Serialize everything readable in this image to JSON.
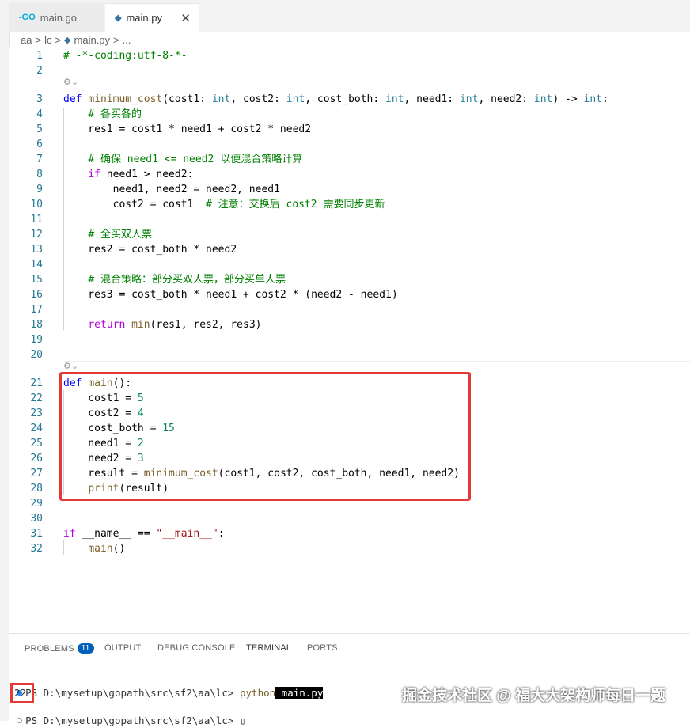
{
  "tabs": [
    {
      "label": "main.go",
      "icon": "go-icon"
    },
    {
      "label": "main.py",
      "icon": "python-icon",
      "close": "✕"
    }
  ],
  "breadcrumb": [
    "aa",
    ">",
    "lc",
    ">",
    "main.py",
    ">",
    "..."
  ],
  "codelens_icon": "⚙⌄",
  "lines": [
    {
      "n": "1",
      "html": "<span class=\"cm\"># -*-coding:utf-8-*-</span>"
    },
    {
      "n": "2",
      "html": ""
    },
    {
      "n": "3",
      "html": "<span class=\"kw\">def</span> <span class=\"fn\">minimum_cost</span>(cost1: <span class=\"ty\">int</span>, cost2: <span class=\"ty\">int</span>, cost_both: <span class=\"ty\">int</span>, need1: <span class=\"ty\">int</span>, need2: <span class=\"ty\">int</span>) -> <span class=\"ty\">int</span>:"
    },
    {
      "n": "4",
      "html": "    <span class=\"cm\"># 各买各的</span>"
    },
    {
      "n": "5",
      "html": "    res1 = cost1 * need1 + cost2 * need2"
    },
    {
      "n": "6",
      "html": ""
    },
    {
      "n": "7",
      "html": "    <span class=\"cm\"># 确保 need1 <= need2 以便混合策略计算</span>"
    },
    {
      "n": "8",
      "html": "    <span class=\"ctl\">if</span> need1 > need2:"
    },
    {
      "n": "9",
      "html": "        need1, need2 = need2, need1"
    },
    {
      "n": "10",
      "html": "        cost2 = cost1  <span class=\"cm\"># 注意：交换后 cost2 需要同步更新</span>"
    },
    {
      "n": "11",
      "html": ""
    },
    {
      "n": "12",
      "html": "    <span class=\"cm\"># 全买双人票</span>"
    },
    {
      "n": "13",
      "html": "    res2 = cost_both * need2"
    },
    {
      "n": "14",
      "html": ""
    },
    {
      "n": "15",
      "html": "    <span class=\"cm\"># 混合策略：部分买双人票，部分买单人票</span>"
    },
    {
      "n": "16",
      "html": "    res3 = cost_both * need1 + cost2 * (need2 - need1)"
    },
    {
      "n": "17",
      "html": ""
    },
    {
      "n": "18",
      "html": "    <span class=\"ctl\">return</span> <span class=\"fn\">min</span>(res1, res2, res3)"
    },
    {
      "n": "19",
      "html": ""
    },
    {
      "n": "20",
      "html": ""
    },
    {
      "n": "21",
      "html": "<span class=\"kw\">def</span> <span class=\"fn\">main</span>():"
    },
    {
      "n": "22",
      "html": "    cost1 = <span class=\"num\">5</span>"
    },
    {
      "n": "23",
      "html": "    cost2 = <span class=\"num\">4</span>"
    },
    {
      "n": "24",
      "html": "    cost_both = <span class=\"num\">15</span>"
    },
    {
      "n": "25",
      "html": "    need1 = <span class=\"num\">2</span>"
    },
    {
      "n": "26",
      "html": "    need2 = <span class=\"num\">3</span>"
    },
    {
      "n": "27",
      "html": "    result = <span class=\"fn\">minimum_cost</span>(cost1, cost2, cost_both, need1, need2)"
    },
    {
      "n": "28",
      "html": "    <span class=\"fn\">print</span>(result)"
    },
    {
      "n": "29",
      "html": ""
    },
    {
      "n": "30",
      "html": ""
    },
    {
      "n": "31",
      "html": "<span class=\"ctl\">if</span> __name__ == <span class=\"str\">\"__main__\"</span>:"
    },
    {
      "n": "32",
      "html": "    <span class=\"fn\">main</span>()"
    }
  ],
  "panel": {
    "tabs": [
      "PROBLEMS",
      "OUTPUT",
      "DEBUG CONSOLE",
      "TERMINAL",
      "PORTS"
    ],
    "problems_count": "11",
    "terminal": {
      "prompt1": "PS D:\\mysetup\\gopath\\src\\sf2\\aa\\lc> ",
      "cmd": "python",
      "arg": " main.py",
      "output": "22",
      "prompt2": "PS D:\\mysetup\\gopath\\src\\sf2\\aa\\lc> ",
      "cursor": "▯"
    }
  },
  "watermark": "掘金技术社区 @ 福大大架构师每日一题",
  "colors": {
    "accent": "#005fb8",
    "highlight_box": "#e53935"
  }
}
